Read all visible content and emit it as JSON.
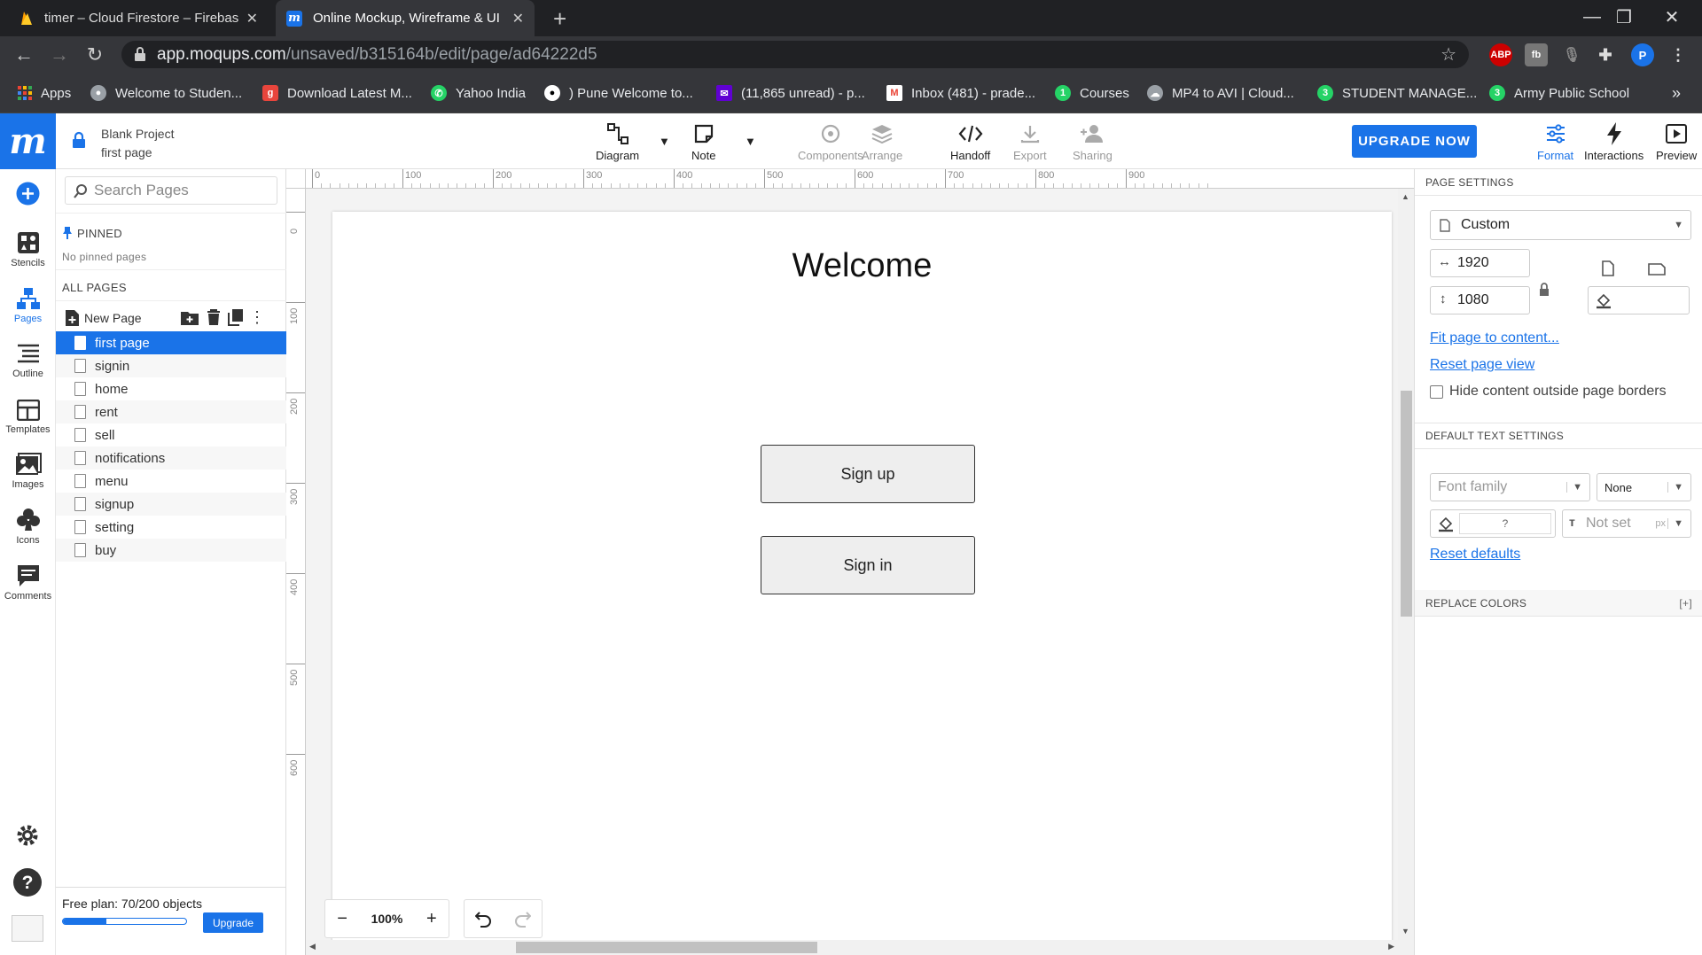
{
  "browser": {
    "tabs": [
      {
        "title": "timer – Cloud Firestore – Firebase",
        "active": false
      },
      {
        "title": "Online Mockup, Wireframe & UI",
        "active": true
      }
    ],
    "url_host": "app.moqups.com",
    "url_path": "/unsaved/b315164b/edit/page/ad64222d5",
    "profile_initial": "P",
    "ext_abp": "ABP",
    "bookmarks": [
      {
        "label": "Apps",
        "color": "#ea4335"
      },
      {
        "label": "Welcome to Studen...",
        "color": "#9aa0a6"
      },
      {
        "label": "Download Latest M...",
        "color": "#e8453c"
      },
      {
        "label": "Yahoo India",
        "color": "#25d366"
      },
      {
        "label": ") Pune Welcome to...",
        "color": "#ffffff"
      },
      {
        "label": "(11,865 unread) - p...",
        "color": "#6001d2"
      },
      {
        "label": "Inbox (481) - prade...",
        "color": "#ea4335"
      },
      {
        "label": "Courses",
        "color": "#25d366"
      },
      {
        "label": "MP4 to AVI | Cloud...",
        "color": "#9aa0a6"
      },
      {
        "label": "STUDENT MANAGE...",
        "color": "#25d366"
      },
      {
        "label": "Army Public School",
        "color": "#25d366"
      }
    ],
    "bookmark_more": "»"
  },
  "app": {
    "logo": "m",
    "project_name": "Blank Project",
    "current_page": "first page",
    "toolbar": {
      "diagram": "Diagram",
      "note": "Note",
      "components": "Components",
      "arrange": "Arrange",
      "handoff": "Handoff",
      "export": "Export",
      "sharing": "Sharing",
      "upgrade": "UPGRADE NOW",
      "format": "Format",
      "interactions": "Interactions",
      "preview": "Preview"
    },
    "rail": {
      "stencils": "Stencils",
      "pages": "Pages",
      "outline": "Outline",
      "templates": "Templates",
      "images": "Images",
      "icons": "Icons",
      "comments": "Comments"
    },
    "pages_panel": {
      "search_placeholder": "Search Pages",
      "pinned_label": "PINNED",
      "no_pinned": "No pinned pages",
      "all_pages_label": "ALL PAGES",
      "new_page": "New Page",
      "pages": [
        "first page",
        "signin",
        "home",
        "rent",
        "sell",
        "notifications",
        "menu",
        "signup",
        "setting",
        "buy"
      ],
      "selected_index": 0,
      "plan_text": "Free plan: 70/200 objects",
      "plan_fraction": 0.35,
      "plan_upgrade": "Upgrade"
    },
    "canvas": {
      "ruler_h": [
        "0",
        "100",
        "200",
        "300",
        "400",
        "500",
        "600",
        "700",
        "800",
        "900"
      ],
      "ruler_v": [
        "0",
        "100",
        "200",
        "300",
        "400",
        "500",
        "600"
      ],
      "welcome": "Welcome",
      "signup_button": "Sign up",
      "signin_button": "Sign in",
      "zoom_level": "100%",
      "zoom_out": "−",
      "zoom_in": "+"
    },
    "properties": {
      "page_settings_title": "PAGE SETTINGS",
      "size_preset": "Custom",
      "width": "1920",
      "height": "1080",
      "fit_link": "Fit page to content...",
      "reset_link": "Reset page view",
      "hide_content_label": "Hide content outside page borders",
      "hide_content_checked": false,
      "default_text_title": "DEFAULT TEXT SETTINGS",
      "font_family_placeholder": "Font family",
      "font_weight": "None",
      "text_color_placeholder": "?",
      "font_size_placeholder": "Not set",
      "font_size_unit": "px",
      "reset_defaults": "Reset defaults",
      "replace_colors_title": "REPLACE COLORS",
      "replace_colors_add": "[+]"
    },
    "accent_color": "#1a73e8"
  }
}
